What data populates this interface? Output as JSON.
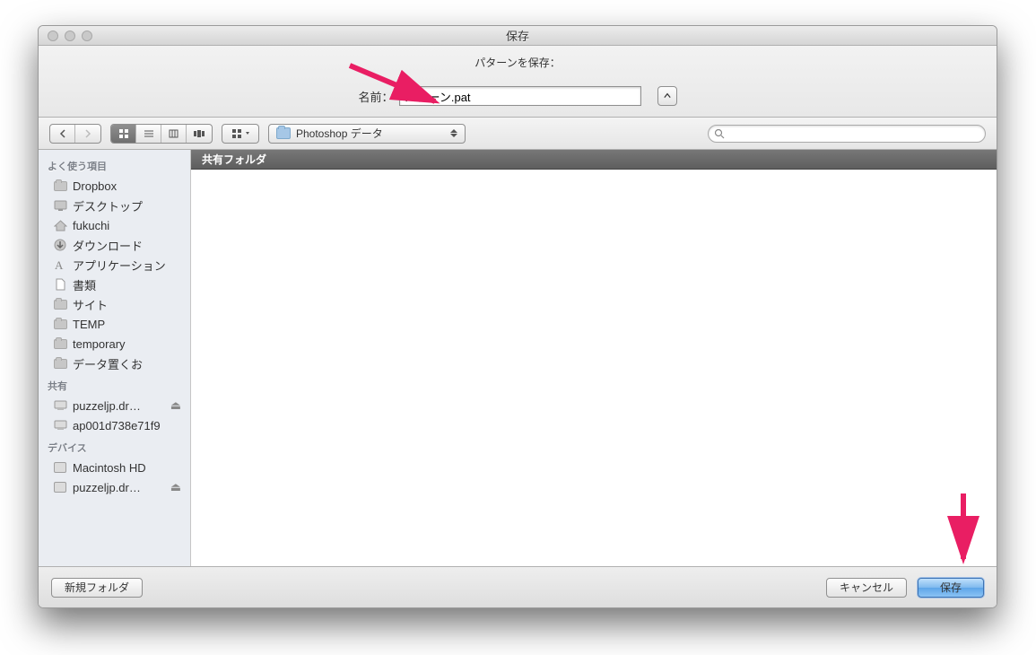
{
  "titlebar": {
    "title": "保存"
  },
  "prompt": {
    "message": "パターンを保存：",
    "name_label": "名前：",
    "filename": "パターン.pat"
  },
  "toolbar": {
    "path_label": "Photoshop データ",
    "search_placeholder": ""
  },
  "sidebar": {
    "sections": [
      {
        "header": "よく使う項目",
        "items": [
          {
            "icon": "folder",
            "label": "Dropbox"
          },
          {
            "icon": "desktop",
            "label": "デスクトップ"
          },
          {
            "icon": "home",
            "label": "fukuchi"
          },
          {
            "icon": "download",
            "label": "ダウンロード"
          },
          {
            "icon": "apps",
            "label": "アプリケーション"
          },
          {
            "icon": "doc",
            "label": "書類"
          },
          {
            "icon": "folder",
            "label": "サイト"
          },
          {
            "icon": "folder",
            "label": "TEMP"
          },
          {
            "icon": "folder",
            "label": "temporary"
          },
          {
            "icon": "folder",
            "label": "データ置くお"
          }
        ]
      },
      {
        "header": "共有",
        "items": [
          {
            "icon": "computer",
            "label": "puzzeljp.dr…",
            "eject": true
          },
          {
            "icon": "computer",
            "label": "ap001d738e71f9"
          }
        ]
      },
      {
        "header": "デバイス",
        "items": [
          {
            "icon": "disk",
            "label": "Macintosh HD"
          },
          {
            "icon": "disk",
            "label": "puzzeljp.dr…",
            "eject": true
          }
        ]
      }
    ]
  },
  "content": {
    "column_header": "共有フォルダ"
  },
  "footer": {
    "new_folder": "新規フォルダ",
    "cancel": "キャンセル",
    "save": "保存"
  }
}
